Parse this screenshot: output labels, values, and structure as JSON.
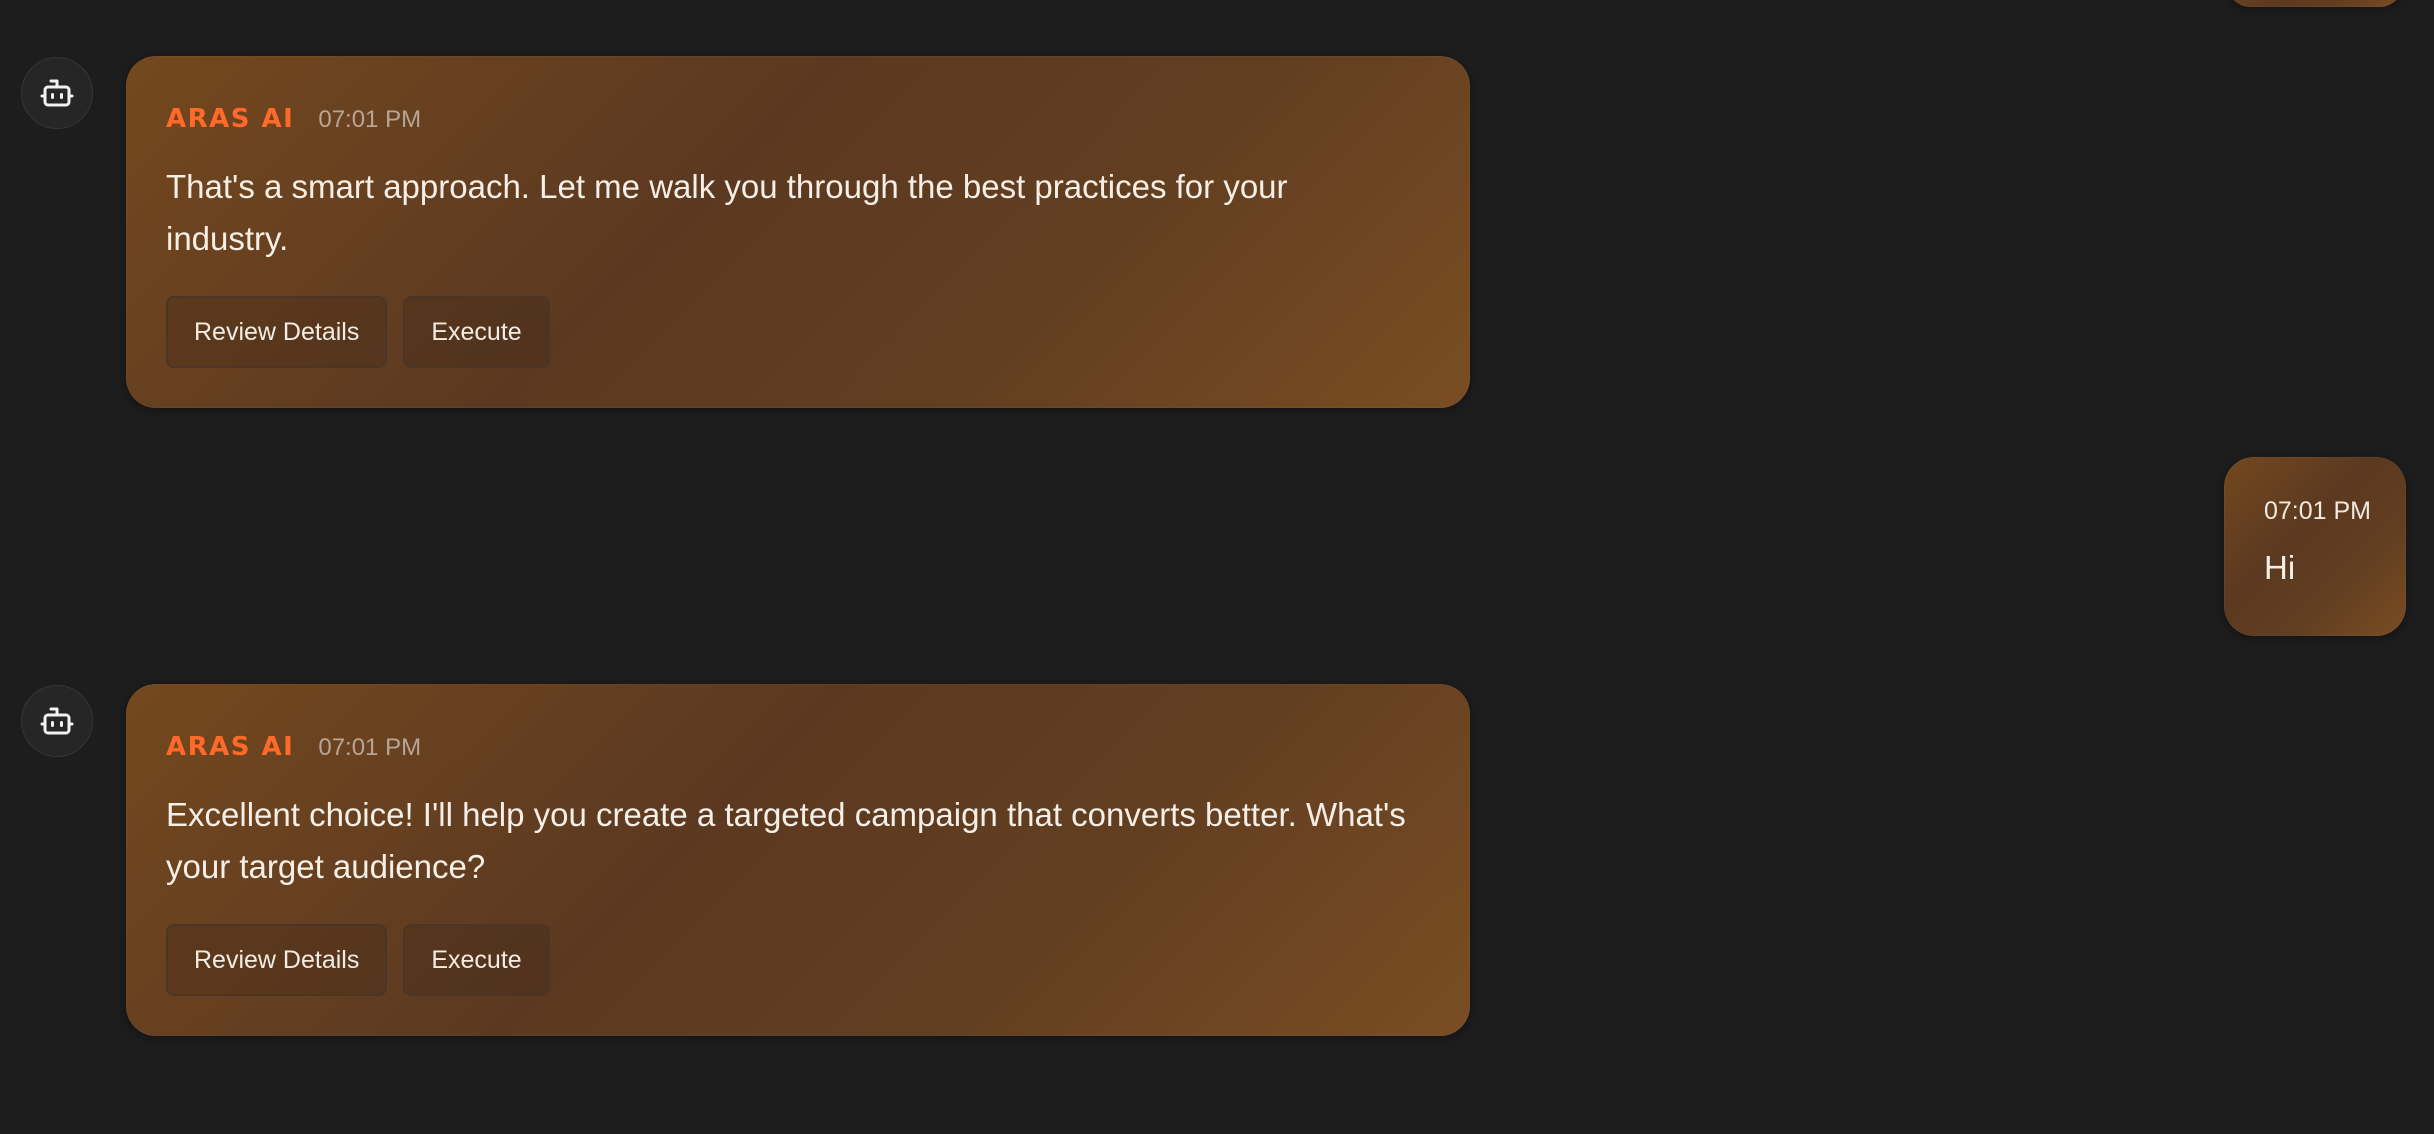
{
  "assistant": {
    "name": "ARAS AI",
    "avatar_icon": "robot-icon",
    "name_color": "#ff6a2a"
  },
  "messages": [
    {
      "role": "assistant",
      "time": "07:01 PM",
      "text": "That's a smart approach. Let me walk you through the best practices for your industry.",
      "actions": [
        "Review Details",
        "Execute"
      ]
    },
    {
      "role": "user",
      "time": "07:01 PM",
      "text": "Hi"
    },
    {
      "role": "assistant",
      "time": "07:01 PM",
      "text": "Excellent choice! I'll help you create a targeted campaign that converts better. What's your target audience?",
      "actions": [
        "Review Details",
        "Execute"
      ]
    }
  ],
  "colors": {
    "background": "#1d1d1d",
    "bubble": "#5b3920",
    "accent": "#ff6a2a"
  }
}
